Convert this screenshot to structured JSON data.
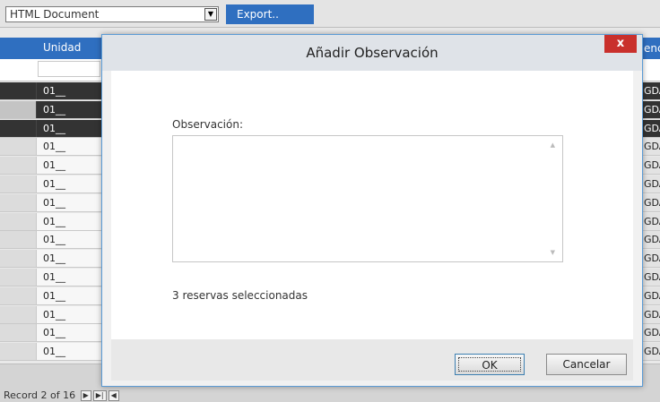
{
  "toolbar": {
    "format_value": "HTML Document",
    "export_label": "Export.."
  },
  "grid": {
    "column_unit": "Unidad",
    "right_col_header_fragment": "enc",
    "right_cell_fragment": "GDA",
    "rows": [
      {
        "unit": "01__",
        "state": "selected"
      },
      {
        "unit": "01__",
        "state": "current"
      },
      {
        "unit": "01__",
        "state": "selected"
      },
      {
        "unit": "01__",
        "state": "normal"
      },
      {
        "unit": "01__",
        "state": "normal"
      },
      {
        "unit": "01__",
        "state": "normal"
      },
      {
        "unit": "01__",
        "state": "normal"
      },
      {
        "unit": "01__",
        "state": "normal"
      },
      {
        "unit": "01__",
        "state": "normal"
      },
      {
        "unit": "01__",
        "state": "normal"
      },
      {
        "unit": "01__",
        "state": "normal"
      },
      {
        "unit": "01__",
        "state": "normal"
      },
      {
        "unit": "01__",
        "state": "normal"
      },
      {
        "unit": "01__",
        "state": "normal"
      },
      {
        "unit": "01__",
        "state": "normal"
      }
    ],
    "pager_text": "Record 2 of 16"
  },
  "dialog": {
    "title": "Añadir Observación",
    "close_label": "x",
    "observation_label": "Observación:",
    "observation_value": "",
    "selection_count_text": "3 reservas seleccionadas",
    "ok_label": "OK",
    "cancel_label": "Cancelar"
  }
}
